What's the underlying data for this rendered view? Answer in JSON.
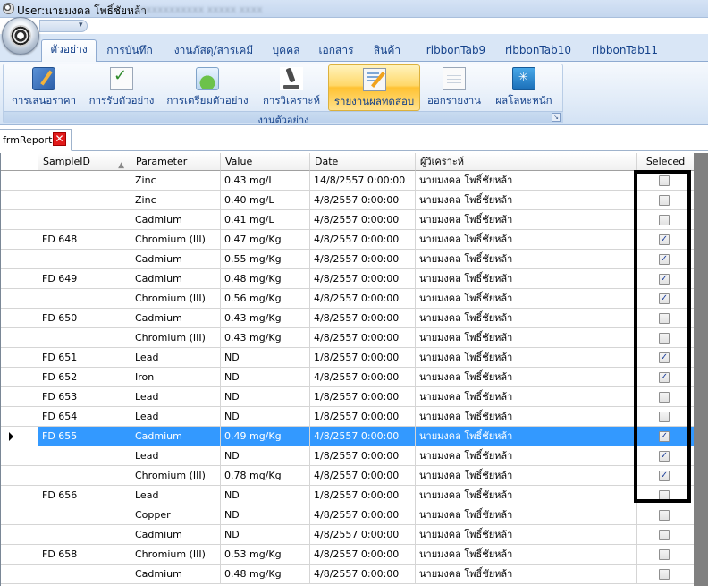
{
  "window": {
    "title": "User:นายมงคล โพธิ์ชัยหล้า",
    "title_blurred": "xxxxxxxxxxxx  xxxxx  xxxx"
  },
  "tabs": [
    {
      "label": "ตัวอย่าง",
      "active": true
    },
    {
      "label": "การบันทึก"
    },
    {
      "label": "งานภัสดุ/สารเคมี"
    },
    {
      "label": "บุคคล"
    },
    {
      "label": "เอกสาร"
    },
    {
      "label": "สินค้า"
    },
    {
      "label": "ribbonTab9"
    },
    {
      "label": "ribbonTab10"
    },
    {
      "label": "ribbonTab11"
    }
  ],
  "ribbon": {
    "group_caption": "งานตัวอย่าง",
    "buttons": [
      {
        "label": "การเสนอราคา",
        "icon": "quotation-icon"
      },
      {
        "label": "การรับตัวอย่าง",
        "icon": "receive-sample-icon"
      },
      {
        "label": "การเตรียมตัวอย่าง",
        "icon": "prepare-sample-icon"
      },
      {
        "label": "การวิเคราะห์",
        "icon": "microscope-icon"
      },
      {
        "label": "รายงานผลทดสอบ",
        "icon": "test-report-icon",
        "active": true
      },
      {
        "label": "ออกรายงาน",
        "icon": "export-report-icon"
      },
      {
        "label": "ผลโลหะหนัก",
        "icon": "heavy-metal-icon"
      }
    ]
  },
  "document_tab": {
    "label": "frmReport"
  },
  "grid": {
    "columns": [
      "SampleID",
      "Parameter",
      "Value",
      "Date",
      "ผู้วิเคราะห์",
      "Seleced"
    ],
    "rows": [
      {
        "sample_id": "",
        "parameter": "Zinc",
        "value": "0.43 mg/L",
        "date": "14/8/2557 0:00:00",
        "analyst": "นายมงคล โพธิ์ชัยหล้า",
        "selected": false
      },
      {
        "sample_id": "",
        "parameter": "Zinc",
        "value": "0.40 mg/L",
        "date": "4/8/2557 0:00:00",
        "analyst": "นายมงคล โพธิ์ชัยหล้า",
        "selected": false
      },
      {
        "sample_id": "",
        "parameter": "Cadmium",
        "value": "0.41 mg/L",
        "date": "4/8/2557 0:00:00",
        "analyst": "นายมงคล โพธิ์ชัยหล้า",
        "selected": false
      },
      {
        "sample_id": "FD 648",
        "parameter": "Chromium (III)",
        "value": "0.47 mg/Kg",
        "date": "4/8/2557 0:00:00",
        "analyst": "นายมงคล โพธิ์ชัยหล้า",
        "selected": true
      },
      {
        "sample_id": "",
        "parameter": "Cadmium",
        "value": "0.55 mg/Kg",
        "date": "4/8/2557 0:00:00",
        "analyst": "นายมงคล โพธิ์ชัยหล้า",
        "selected": true
      },
      {
        "sample_id": "FD 649",
        "parameter": "Cadmium",
        "value": "0.48 mg/Kg",
        "date": "4/8/2557 0:00:00",
        "analyst": "นายมงคล โพธิ์ชัยหล้า",
        "selected": true
      },
      {
        "sample_id": "",
        "parameter": "Chromium (III)",
        "value": "0.56 mg/Kg",
        "date": "4/8/2557 0:00:00",
        "analyst": "นายมงคล โพธิ์ชัยหล้า",
        "selected": true
      },
      {
        "sample_id": "FD 650",
        "parameter": "Cadmium",
        "value": "0.43 mg/Kg",
        "date": "4/8/2557 0:00:00",
        "analyst": "นายมงคล โพธิ์ชัยหล้า",
        "selected": false
      },
      {
        "sample_id": "",
        "parameter": "Chromium (III)",
        "value": "0.43 mg/Kg",
        "date": "4/8/2557 0:00:00",
        "analyst": "นายมงคล โพธิ์ชัยหล้า",
        "selected": false
      },
      {
        "sample_id": "FD 651",
        "parameter": "Lead",
        "value": "ND",
        "date": "1/8/2557 0:00:00",
        "analyst": "นายมงคล โพธิ์ชัยหล้า",
        "selected": true
      },
      {
        "sample_id": "FD 652",
        "parameter": "Iron",
        "value": "ND",
        "date": "4/8/2557 0:00:00",
        "analyst": "นายมงคล โพธิ์ชัยหล้า",
        "selected": true
      },
      {
        "sample_id": "FD 653",
        "parameter": "Lead",
        "value": "ND",
        "date": "1/8/2557 0:00:00",
        "analyst": "นายมงคล โพธิ์ชัยหล้า",
        "selected": false
      },
      {
        "sample_id": "FD 654",
        "parameter": "Lead",
        "value": "ND",
        "date": "1/8/2557 0:00:00",
        "analyst": "นายมงคล โพธิ์ชัยหล้า",
        "selected": false
      },
      {
        "sample_id": "FD 655",
        "parameter": "Cadmium",
        "value": "0.49 mg/Kg",
        "date": "4/8/2557 0:00:00",
        "analyst": "นายมงคล โพธิ์ชัยหล้า",
        "selected": true,
        "current": true
      },
      {
        "sample_id": "",
        "parameter": "Lead",
        "value": "ND",
        "date": "1/8/2557 0:00:00",
        "analyst": "นายมงคล โพธิ์ชัยหล้า",
        "selected": true
      },
      {
        "sample_id": "",
        "parameter": "Chromium (III)",
        "value": "0.78 mg/Kg",
        "date": "4/8/2557 0:00:00",
        "analyst": "นายมงคล โพธิ์ชัยหล้า",
        "selected": true
      },
      {
        "sample_id": "FD 656",
        "parameter": "Lead",
        "value": "ND",
        "date": "1/8/2557 0:00:00",
        "analyst": "นายมงคล โพธิ์ชัยหล้า",
        "selected": false
      },
      {
        "sample_id": "",
        "parameter": "Copper",
        "value": "ND",
        "date": "4/8/2557 0:00:00",
        "analyst": "นายมงคล โพธิ์ชัยหล้า",
        "selected": false
      },
      {
        "sample_id": "",
        "parameter": "Cadmium",
        "value": "ND",
        "date": "4/8/2557 0:00:00",
        "analyst": "นายมงคล โพธิ์ชัยหล้า",
        "selected": false
      },
      {
        "sample_id": "FD 658",
        "parameter": "Chromium (III)",
        "value": "0.53 mg/Kg",
        "date": "4/8/2557 0:00:00",
        "analyst": "นายมงคล โพธิ์ชัยหล้า",
        "selected": false
      },
      {
        "sample_id": "",
        "parameter": "Cadmium",
        "value": "0.48 mg/Kg",
        "date": "4/8/2557 0:00:00",
        "analyst": "นายมงคล โพธิ์ชัยหล้า",
        "selected": false
      }
    ]
  },
  "colors": {
    "selection": "#3399ff",
    "ribbon_text": "#15428b",
    "active_button": "#ffc232"
  }
}
